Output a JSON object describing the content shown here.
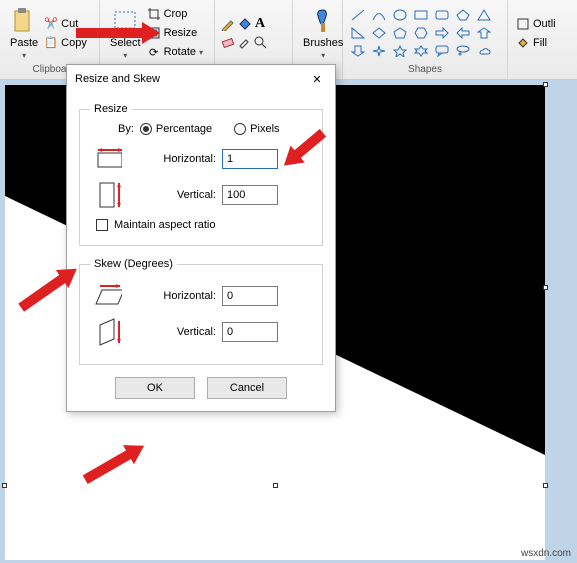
{
  "ribbon": {
    "clipboard": {
      "label": "Clipboa",
      "paste": "Paste",
      "cut": "Cut",
      "copy": "Copy"
    },
    "image": {
      "select": "Select",
      "crop": "Crop",
      "resize": "Resize",
      "rotate": "Rotate"
    },
    "tools": {
      "brushes": "Brushes"
    },
    "shapes": {
      "label": "Shapes"
    },
    "right": {
      "outline": "Outli",
      "fill": "Fill"
    }
  },
  "dialog": {
    "title": "Resize and Skew",
    "resize": {
      "legend": "Resize",
      "by": "By:",
      "percentage": "Percentage",
      "pixels": "Pixels",
      "horizontal": "Horizontal:",
      "vertical": "Vertical:",
      "h_val": "1",
      "v_val": "100",
      "maintain": "Maintain aspect ratio"
    },
    "skew": {
      "legend": "Skew (Degrees)",
      "horizontal": "Horizontal:",
      "vertical": "Vertical:",
      "h_val": "0",
      "v_val": "0"
    },
    "ok": "OK",
    "cancel": "Cancel"
  },
  "watermark": "wsxdn.com"
}
